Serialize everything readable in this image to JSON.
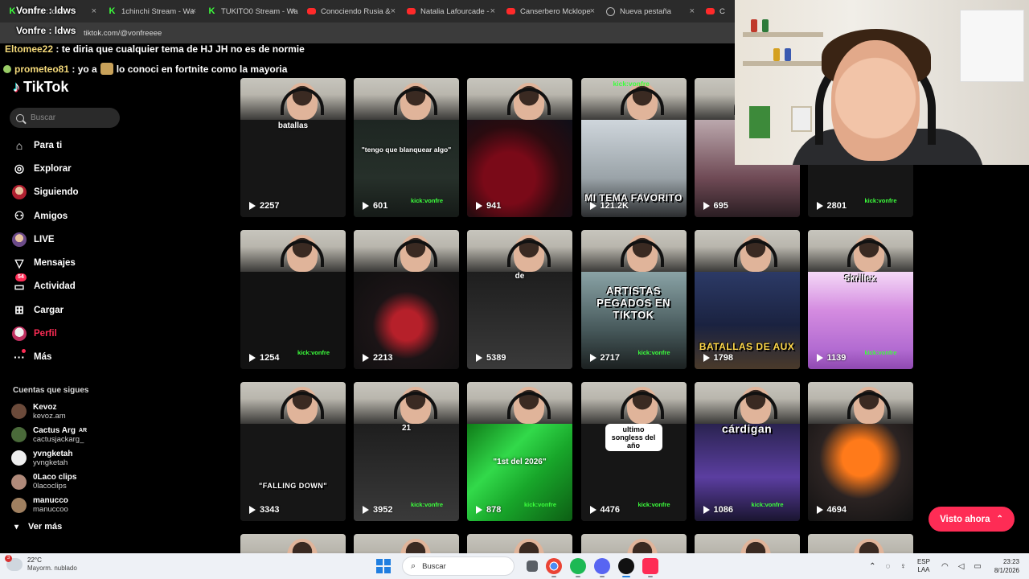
{
  "browser": {
    "tabs": [
      {
        "title": "Vonfre : ldws",
        "icon": "kick-icon"
      },
      {
        "title": "1chinchi Stream - Wa",
        "icon": "kick-icon"
      },
      {
        "title": "TUKITO0 Stream - Wa",
        "icon": "kick-icon"
      },
      {
        "title": "Conociendo Rusia &",
        "icon": "youtube-icon"
      },
      {
        "title": "Natalia Lafourcade -",
        "icon": "youtube-icon"
      },
      {
        "title": "Canserbero Mcklope",
        "icon": "youtube-icon"
      },
      {
        "title": "Nueva pestaña",
        "icon": "globe-icon"
      },
      {
        "title": "C",
        "icon": "youtube-icon"
      }
    ],
    "url": "tiktok.com/@vonfreeee"
  },
  "chat": [
    {
      "user": "Vonfre",
      "message": "ldws"
    },
    {
      "user": "Vonfre",
      "message": "ldws"
    },
    {
      "user": "Eltomee22",
      "message": "te diria que cualquier tema de HJ JH no es de normie"
    },
    {
      "user": "prometeo81",
      "message": "yo a",
      "message2": "lo conoci en fortnite como la mayoria"
    }
  ],
  "sidebar": {
    "brand": "TikTok",
    "search_placeholder": "Buscar",
    "nav": [
      {
        "label": "Para ti",
        "icon": "home-icon"
      },
      {
        "label": "Explorar",
        "icon": "compass-icon"
      },
      {
        "label": "Siguiendo",
        "icon": "following-avatar-icon"
      },
      {
        "label": "Amigos",
        "icon": "friends-icon"
      },
      {
        "label": "LIVE",
        "icon": "live-avatar-icon"
      },
      {
        "label": "Mensajes",
        "icon": "message-icon"
      },
      {
        "label": "Actividad",
        "icon": "activity-icon",
        "badge": "54"
      },
      {
        "label": "Cargar",
        "icon": "upload-icon"
      },
      {
        "label": "Perfil",
        "icon": "profile-avatar-icon",
        "active": true
      },
      {
        "label": "Más",
        "icon": "more-icon"
      }
    ],
    "following_title": "Cuentas que sigues",
    "following": [
      {
        "name": "Kevoz",
        "user": "kevoz.am",
        "color": "#6b4a3a"
      },
      {
        "name": "Cactus Arg",
        "suffix": "AR",
        "user": "cactusjackarg_",
        "color": "#4a6a3a"
      },
      {
        "name": "yvngketah",
        "user": "yvngketah",
        "color": "#eeeeee"
      },
      {
        "name": "0Laco clips",
        "user": "0lacoclips",
        "color": "#b08a7a"
      },
      {
        "name": "manucco",
        "user": "manuccoo",
        "color": "#a08060"
      }
    ],
    "see_more": "Ver más"
  },
  "videos": [
    {
      "views": "2257",
      "text": "batallas",
      "style": "b-dark"
    },
    {
      "views": "601",
      "text": "\"tengo que blanquear algo\"",
      "style": "b-teal"
    },
    {
      "views": "941",
      "text": "",
      "style": "b-red"
    },
    {
      "views": "121.2K",
      "text": "MI TEMA FAVORITO",
      "style": "b-room"
    },
    {
      "views": "695",
      "text": "",
      "style": "b-pink"
    },
    {
      "views": "2801",
      "text": "",
      "style": "b-dark"
    },
    {
      "views": "1254",
      "text": "",
      "style": "b-list"
    },
    {
      "views": "2213",
      "text": "",
      "style": "b-redhair"
    },
    {
      "views": "5389",
      "text": "de",
      "style": "b-mix"
    },
    {
      "views": "2717",
      "text": "ARTISTAS PEGADOS EN TIKTOK",
      "style": "b-artist"
    },
    {
      "views": "1798",
      "text": "BATALLAS DE AUX",
      "style": "b-blue"
    },
    {
      "views": "1139",
      "text": "Skrillex",
      "style": "b-violet"
    },
    {
      "views": "3343",
      "text": "\"FALLING DOWN\"",
      "style": "b-dark"
    },
    {
      "views": "3952",
      "text": "21",
      "style": "b-mix"
    },
    {
      "views": "878",
      "text": "\"1st del 2026\"",
      "style": "b-green"
    },
    {
      "views": "4476",
      "text": "ultimo songless del año",
      "style": "b-dark"
    },
    {
      "views": "1086",
      "text": "cárdigan",
      "style": "b-purple"
    },
    {
      "views": "4694",
      "text": "",
      "style": "b-orange"
    }
  ],
  "kick_tag": "kick:vonfre",
  "visto_ahora": "Visto ahora",
  "taskbar": {
    "temp": "22°C",
    "condition": "Mayorm. nublado",
    "weather_badge": "3",
    "search": "Buscar",
    "lang1": "ESP",
    "lang2": "LAA",
    "time": "23:23",
    "date": "8/1/2026"
  }
}
